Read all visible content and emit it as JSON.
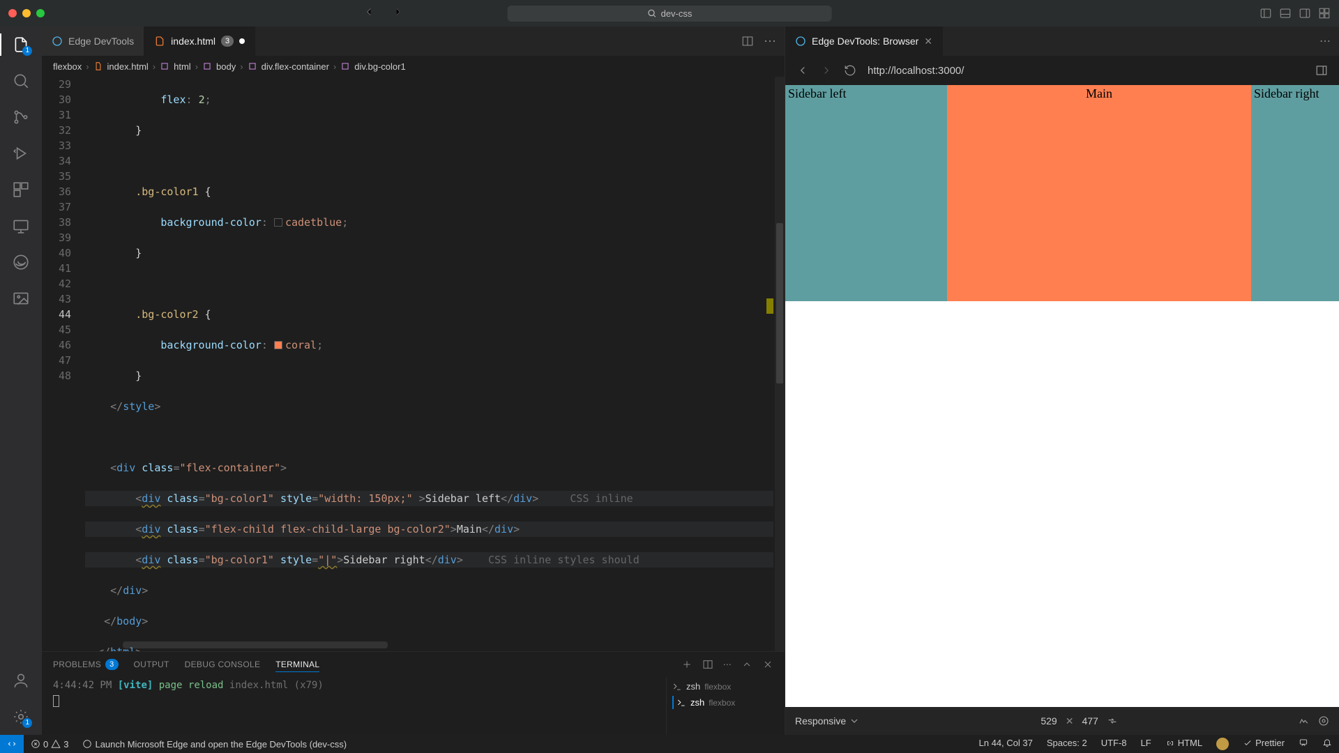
{
  "title_search": "dev-css",
  "tabs": [
    {
      "label": "Edge DevTools",
      "active": false
    },
    {
      "label": "index.html",
      "active": true,
      "badge": "3",
      "dirty": true
    }
  ],
  "breadcrumb": [
    "flexbox",
    "index.html",
    "html",
    "body",
    "div.flex-container",
    "div.bg-color1"
  ],
  "lines": [
    29,
    30,
    31,
    32,
    33,
    34,
    35,
    36,
    37,
    38,
    39,
    40,
    41,
    42,
    43,
    44,
    45,
    46,
    47,
    48
  ],
  "current_line": 44,
  "code_tokens": {
    "l29": {
      "prop": "flex",
      "val": "2"
    },
    "l32": {
      "sel": ".bg-color1"
    },
    "l33": {
      "prop": "background-color",
      "swatch": "#5f9ea0",
      "val": "cadetblue"
    },
    "l36": {
      "sel": ".bg-color2"
    },
    "l37": {
      "prop": "background-color",
      "swatch": "#ff7f50",
      "val": "coral"
    },
    "l39": {
      "tag": "style"
    },
    "l41": {
      "cls": "flex-container"
    },
    "l42": {
      "cls": "bg-color1",
      "style": "width: 150px;",
      "text": "Sidebar left",
      "hint": "CSS inline"
    },
    "l43": {
      "cls": "flex-child flex-child-large bg-color2",
      "text": "Main"
    },
    "l44": {
      "cls": "bg-color1",
      "style": "|",
      "text": "Sidebar right",
      "hint": "CSS inline styles should"
    },
    "l46": {
      "tag": "body"
    },
    "l47": {
      "tag": "html"
    }
  },
  "panel": {
    "tabs": [
      "PROBLEMS",
      "OUTPUT",
      "DEBUG CONSOLE",
      "TERMINAL"
    ],
    "problems_count": "3",
    "active": "TERMINAL",
    "term_line": {
      "time": "4:44:42 PM",
      "vite": "[vite]",
      "msg": "page reload",
      "file": "index.html",
      "extra": "(x79)"
    },
    "shells": [
      {
        "name": "zsh",
        "sub": "flexbox"
      },
      {
        "name": "zsh",
        "sub": "flexbox"
      }
    ]
  },
  "browser": {
    "tab": "Edge DevTools: Browser",
    "url": "http://localhost:3000/",
    "sidebar_left": "Sidebar left",
    "main": "Main",
    "sidebar_right": "Sidebar right",
    "device": "Responsive",
    "w": "529",
    "h": "477"
  },
  "status": {
    "errors": "0",
    "warnings": "3",
    "launch": "Launch Microsoft Edge and open the Edge DevTools (dev-css)",
    "pos": "Ln 44, Col 37",
    "spaces": "Spaces: 2",
    "enc": "UTF-8",
    "eol": "LF",
    "lang": "HTML",
    "prettier": "Prettier"
  }
}
